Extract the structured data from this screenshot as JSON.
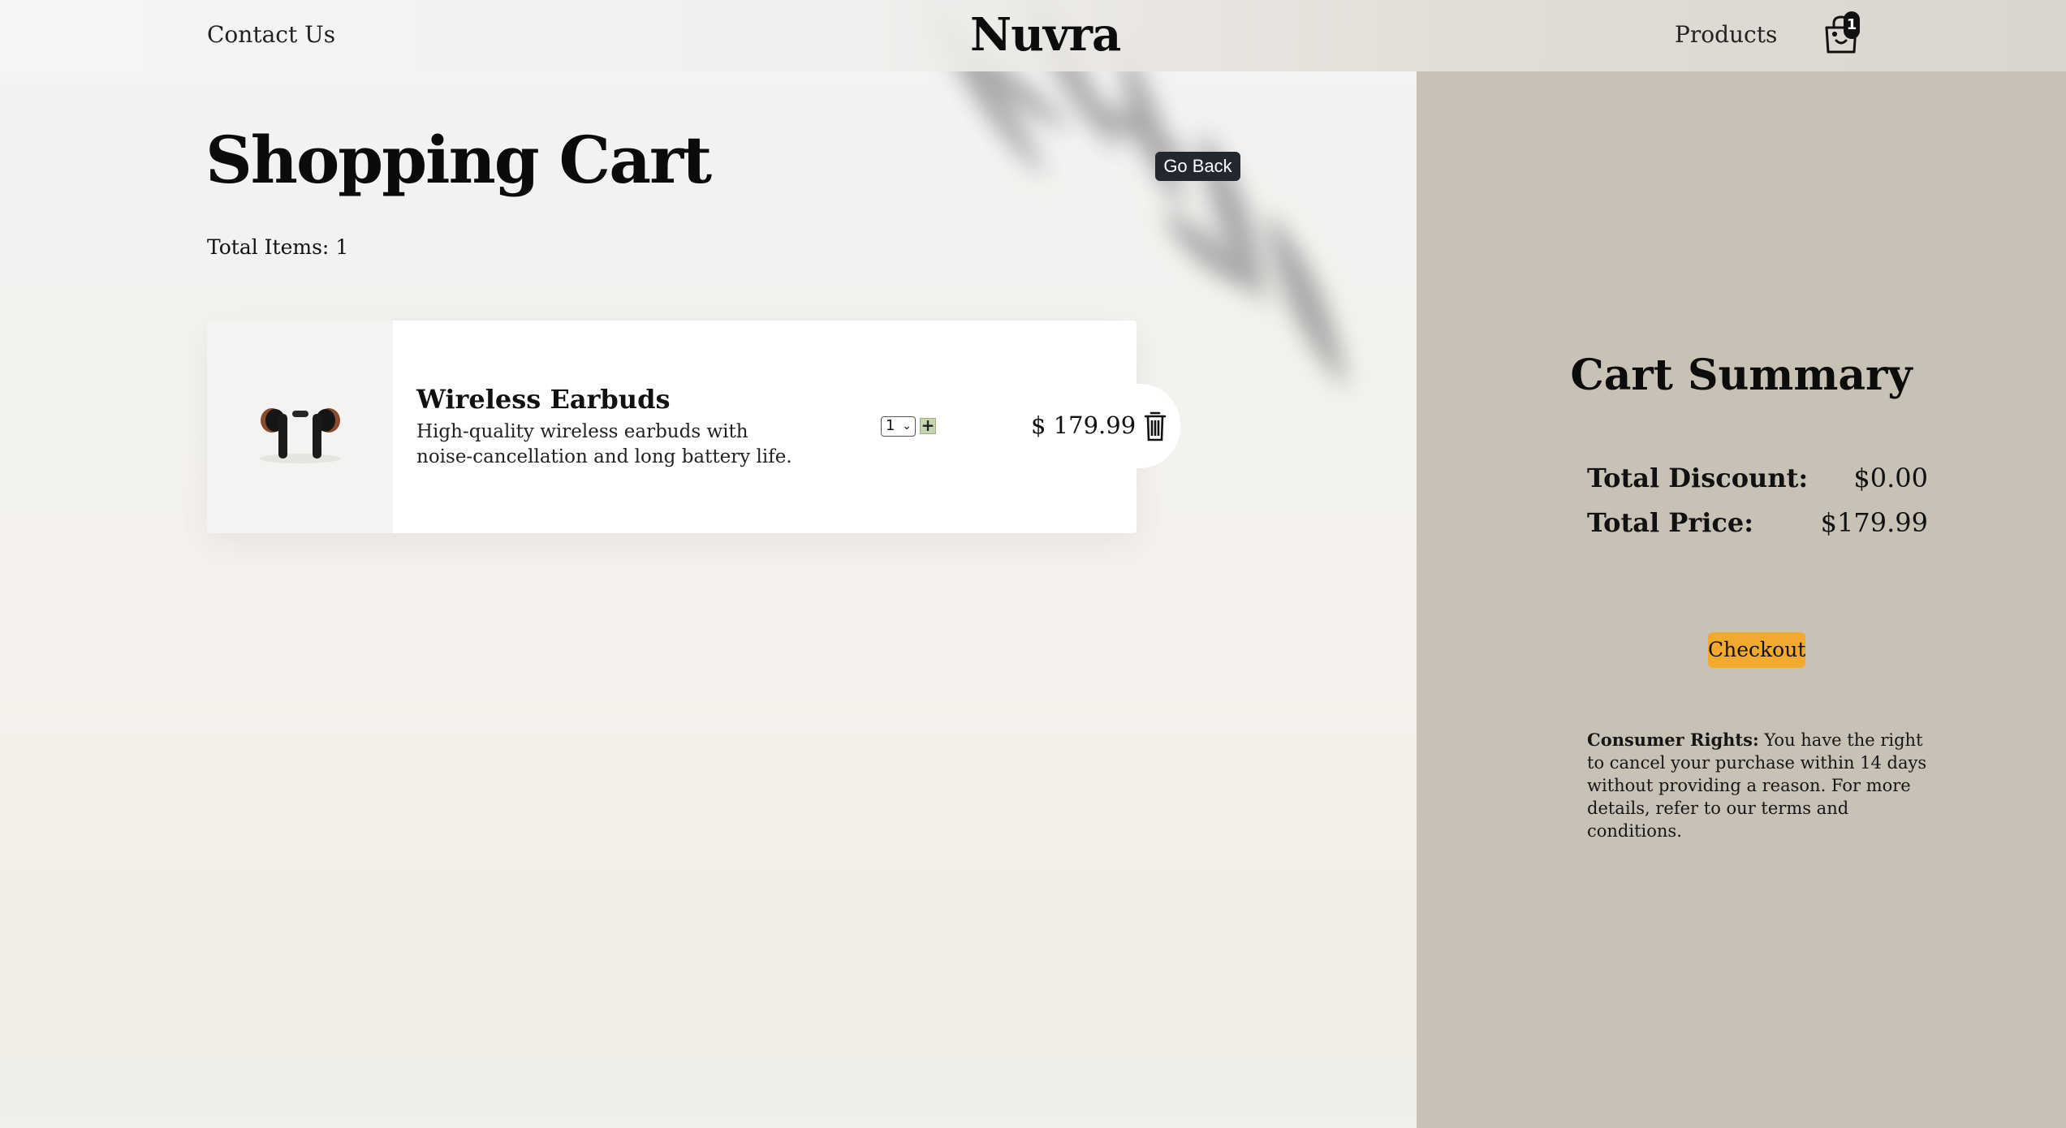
{
  "header": {
    "contact_label": "Contact Us",
    "brand": "Nuvra",
    "products_label": "Products",
    "cart_count": "1",
    "cart_icon": "shopping-bag-icon"
  },
  "cart": {
    "title": "Shopping Cart",
    "go_back_label": "Go Back",
    "total_items_label": "Total Items:",
    "total_items_value": "1",
    "items": [
      {
        "name": "Wireless Earbuds",
        "description": "High-quality wireless earbuds with noise-cancellation and long battery life.",
        "quantity": "1",
        "plus_label": "+",
        "price": "$ 179.99",
        "image_icon": "earbuds-image",
        "delete_icon": "trash-icon"
      }
    ]
  },
  "summary": {
    "title": "Cart Summary",
    "discount_label": "Total Discount:",
    "discount_value": "$0.00",
    "price_label": "Total Price:",
    "price_value": "$179.99",
    "checkout_label": "Checkout",
    "consumer_rights_label": "Consumer Rights:",
    "consumer_rights_text": "You have the right to cancel your purchase within 14 days without providing a reason. For more details, refer to our terms and conditions."
  },
  "colors": {
    "summary_panel": "#c8c1b6",
    "checkout": "#f2a930",
    "go_back": "#232730",
    "plus_button": "#c7d6b0"
  }
}
